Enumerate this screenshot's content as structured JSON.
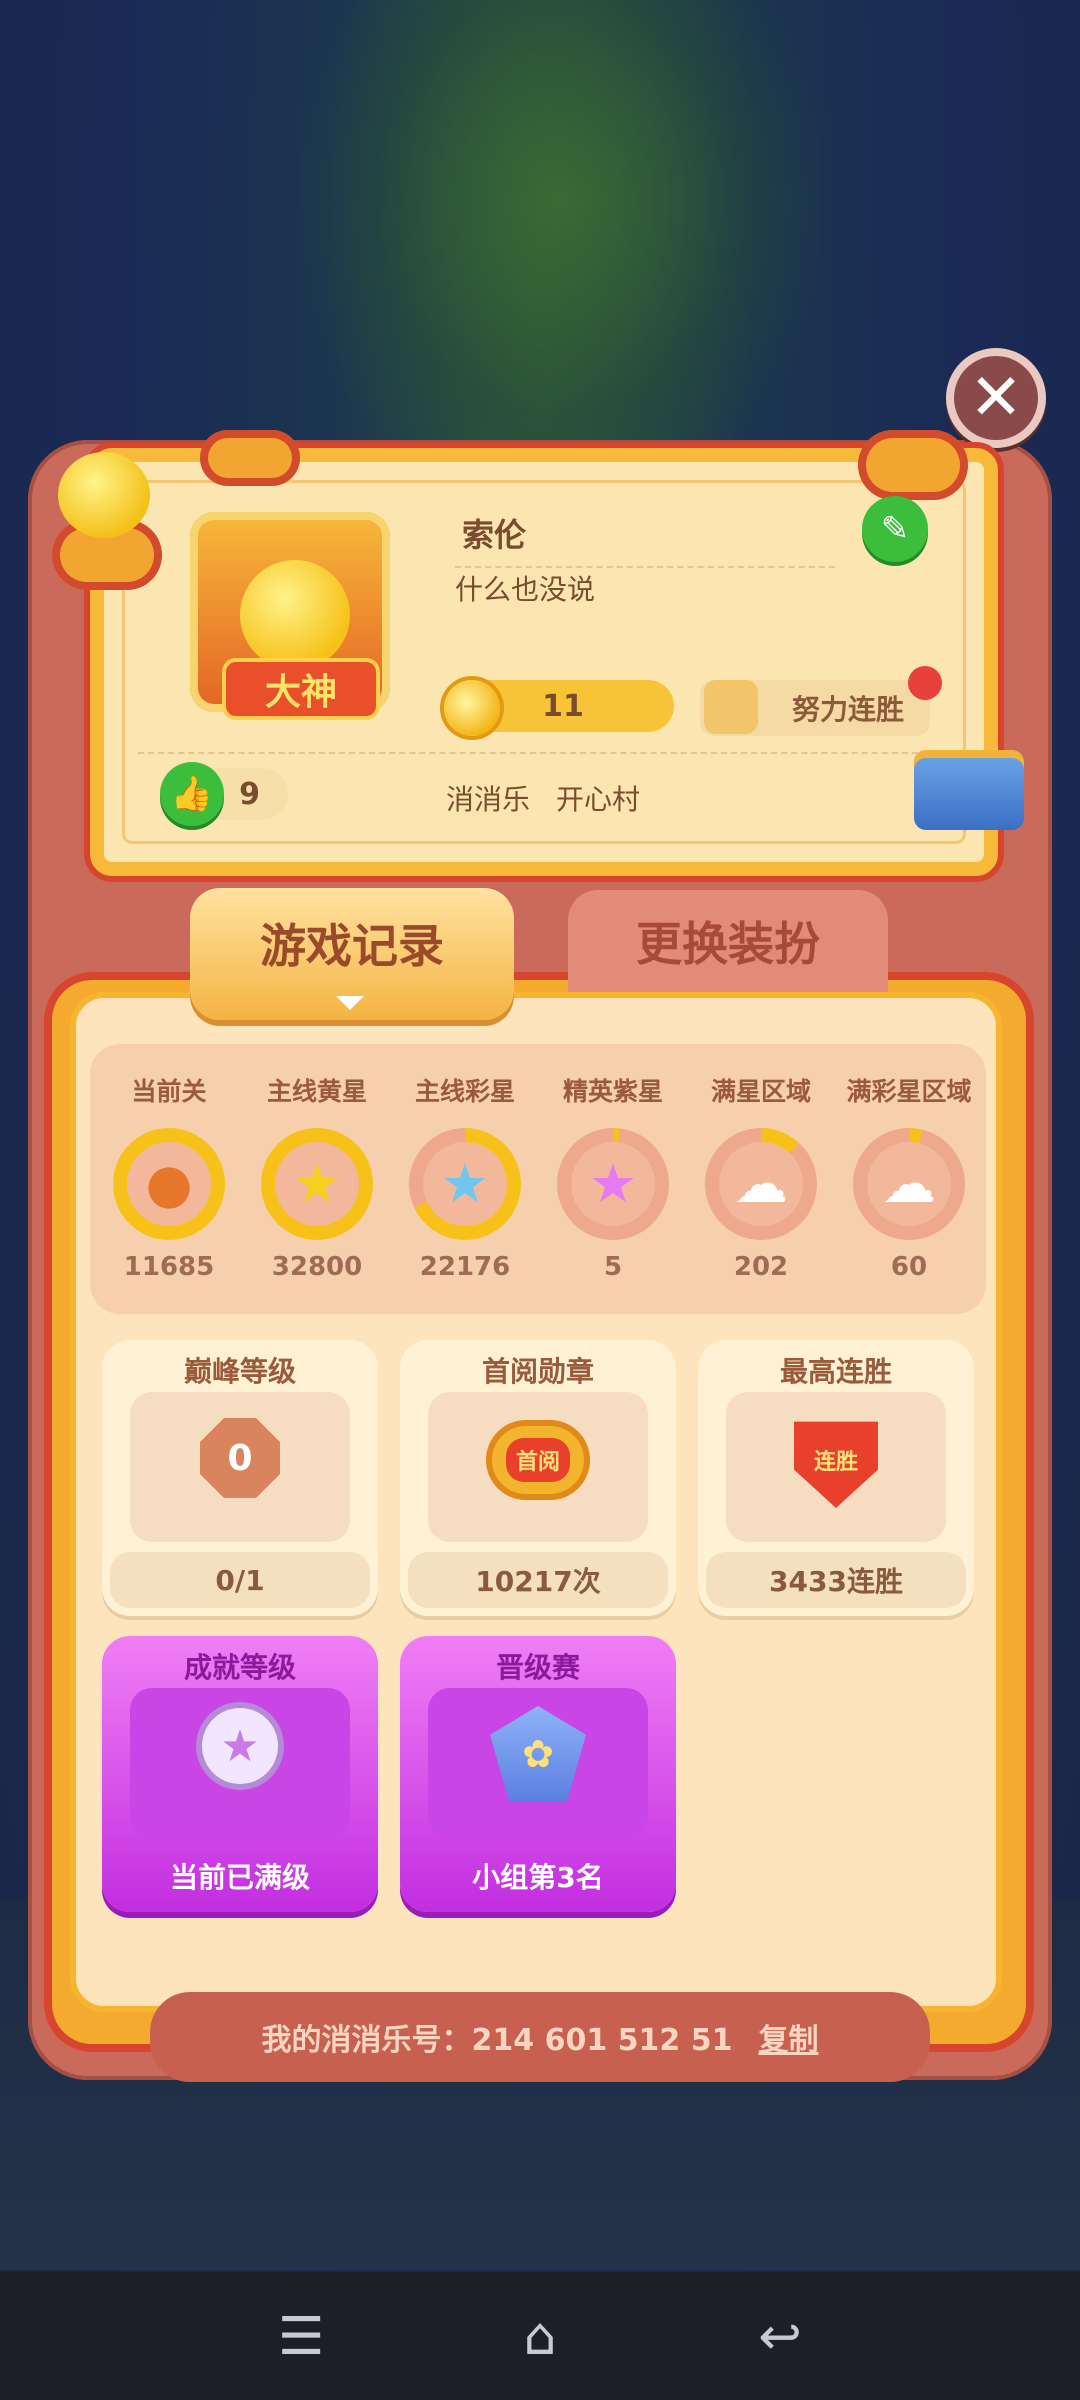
{
  "profile": {
    "name": "索伦",
    "bio": "什么也没说",
    "avatar_badge": "大神",
    "coins": "11",
    "streak_label": "努力连胜",
    "likes": "9",
    "game": "消消乐",
    "village": "开心村"
  },
  "tabs": [
    {
      "label": "游戏记录",
      "active": true
    },
    {
      "label": "更换装扮",
      "active": false
    }
  ],
  "stats": [
    {
      "label": "当前关",
      "value": "11685",
      "icon": "fruit-icon",
      "progress": 1.0
    },
    {
      "label": "主线黄星",
      "value": "32800",
      "icon": "yellow-star-icon",
      "progress": 1.0
    },
    {
      "label": "主线彩星",
      "value": "22176",
      "icon": "rainbow-star-icon",
      "progress": 0.68
    },
    {
      "label": "精英紫星",
      "value": "5",
      "icon": "purple-star-icon",
      "progress": 0.02
    },
    {
      "label": "满星区域",
      "value": "202",
      "icon": "star-cloud-icon",
      "progress": 0.12
    },
    {
      "label": "满彩星区域",
      "value": "60",
      "icon": "rainbow-cloud-icon",
      "progress": 0.04
    }
  ],
  "cards": {
    "peak": {
      "title": "巅峰等级",
      "value": "0/1",
      "icon_text": "0"
    },
    "first_read": {
      "title": "首阅勋章",
      "value": "10217次",
      "icon_text": "首阅"
    },
    "max_streak": {
      "title": "最高连胜",
      "value": "3433连胜",
      "icon_text": "连胜"
    },
    "achievement": {
      "title": "成就等级",
      "value": "当前已满级"
    },
    "promotion": {
      "title": "晋级赛",
      "value": "小组第3名"
    }
  },
  "footer": {
    "id_label": "我的消消乐号：214 601 512 51",
    "copy_label": "复制"
  },
  "colors": {
    "accent": "#f4aa2e",
    "frame_red": "#d8452f",
    "panel": "#c96a5a",
    "purple_card": "#c22ee0"
  }
}
